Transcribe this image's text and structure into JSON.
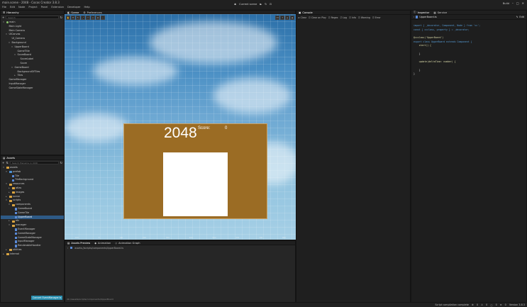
{
  "window": {
    "title": "main.scene - 2048 - Cocos Creator 3.8.3"
  },
  "menu": [
    "File",
    "Edit",
    "Node",
    "Project",
    "Panel",
    "Extension",
    "Developer",
    "Help"
  ],
  "toolbar": {
    "scene_select": "Current scene",
    "build": "Build"
  },
  "hierarchy": {
    "tab": "Hierarchy",
    "search_placeholder": "Search",
    "nodes": [
      {
        "label": "main",
        "depth": 0,
        "caret": "▾",
        "icon": "scene"
      },
      {
        "label": "Main Light",
        "depth": 1,
        "caret": "",
        "icon": "none"
      },
      {
        "label": "Main Camera",
        "depth": 1,
        "caret": "",
        "icon": "none"
      },
      {
        "label": "UICanvas",
        "depth": 1,
        "caret": "▾",
        "icon": "none"
      },
      {
        "label": "UI_Camera",
        "depth": 2,
        "caret": "",
        "icon": "none"
      },
      {
        "label": "Background",
        "depth": 2,
        "caret": "▾",
        "icon": "none"
      },
      {
        "label": "UpperBoard",
        "depth": 3,
        "caret": "▾",
        "icon": "none"
      },
      {
        "label": "GameTitle",
        "depth": 4,
        "caret": "",
        "icon": "none"
      },
      {
        "label": "ScoreBoard",
        "depth": 4,
        "caret": "▾",
        "icon": "none"
      },
      {
        "label": "ScoreLabel",
        "depth": 5,
        "caret": "",
        "icon": "none"
      },
      {
        "label": "Score",
        "depth": 5,
        "caret": "",
        "icon": "none"
      },
      {
        "label": "GameBoard",
        "depth": 3,
        "caret": "▾",
        "icon": "none"
      },
      {
        "label": "BackgroundOfTiles",
        "depth": 4,
        "caret": "",
        "icon": "none"
      },
      {
        "label": "Tiles",
        "depth": 4,
        "caret": "▸",
        "icon": "none"
      },
      {
        "label": "GameManager",
        "depth": 1,
        "caret": "",
        "icon": "none"
      },
      {
        "label": "InputManager",
        "depth": 1,
        "caret": "",
        "icon": "none"
      },
      {
        "label": "GameStateManager",
        "depth": 1,
        "caret": "",
        "icon": "none"
      }
    ]
  },
  "assets": {
    "tab": "Assets",
    "search_placeholder": "Search filename in UUID",
    "nodes": [
      {
        "label": "assets",
        "depth": 0,
        "caret": "▾",
        "icon": "folder",
        "selected": false
      },
      {
        "label": "prefab",
        "depth": 1,
        "caret": "▾",
        "icon": "folder-blue",
        "selected": false
      },
      {
        "label": "Tile",
        "depth": 2,
        "caret": "",
        "icon": "file",
        "selected": false
      },
      {
        "label": "TileBackground",
        "depth": 2,
        "caret": "",
        "icon": "file",
        "selected": false
      },
      {
        "label": "resources",
        "depth": 1,
        "caret": "▾",
        "icon": "folder",
        "selected": false
      },
      {
        "label": "atlas",
        "depth": 2,
        "caret": "▸",
        "icon": "folder",
        "selected": false
      },
      {
        "label": "images",
        "depth": 2,
        "caret": "▸",
        "icon": "folder",
        "selected": false
      },
      {
        "label": "scene",
        "depth": 1,
        "caret": "▸",
        "icon": "folder",
        "selected": false
      },
      {
        "label": "scripts",
        "depth": 1,
        "caret": "▾",
        "icon": "folder",
        "selected": false
      },
      {
        "label": "components",
        "depth": 2,
        "caret": "▾",
        "icon": "folder",
        "selected": false
      },
      {
        "label": "GameBoard",
        "depth": 3,
        "caret": "",
        "icon": "file",
        "selected": false
      },
      {
        "label": "GameTile",
        "depth": 3,
        "caret": "",
        "icon": "file",
        "selected": false
      },
      {
        "label": "UpperBoard",
        "depth": 3,
        "caret": "",
        "icon": "file",
        "selected": true
      },
      {
        "label": "etc",
        "depth": 2,
        "caret": "▸",
        "icon": "folder",
        "selected": false
      },
      {
        "label": "manager",
        "depth": 2,
        "caret": "▾",
        "icon": "folder",
        "selected": false
      },
      {
        "label": "EventManager",
        "depth": 3,
        "caret": "",
        "icon": "file",
        "selected": false
      },
      {
        "label": "GameManager",
        "depth": 3,
        "caret": "",
        "icon": "file",
        "selected": false
      },
      {
        "label": "GameStateManager",
        "depth": 3,
        "caret": "",
        "icon": "file",
        "selected": false
      },
      {
        "label": "InputManager",
        "depth": 3,
        "caret": "",
        "icon": "file",
        "selected": false
      },
      {
        "label": "RenderableHandler",
        "depth": 3,
        "caret": "",
        "icon": "file",
        "selected": false
      },
      {
        "label": "utilities",
        "depth": 1,
        "caret": "▸",
        "icon": "folder",
        "selected": false
      },
      {
        "label": "internal",
        "depth": 0,
        "caret": "▸",
        "icon": "folder",
        "selected": false
      }
    ],
    "footer_tag": "Convert EventManager.ts"
  },
  "scene": {
    "tabs": [
      "Scene",
      "Preferences"
    ],
    "game_title": "2048",
    "score_label": "Score:",
    "score_value": "0",
    "axis_ticks": [
      "-100",
      "0",
      "100",
      "200",
      "300",
      "400",
      "500",
      "600",
      "700",
      "800"
    ]
  },
  "bottom": {
    "tabs": [
      "Assets Preview",
      "Animation",
      "Animation Graph"
    ],
    "path": "assets://scripts/components/UpperBoard.ts",
    "status_path": "db://assets/scripts/components/UpperBoard"
  },
  "console": {
    "tab": "Console",
    "buttons": [
      "Clear",
      "Clear on Play",
      "Regex",
      "Log",
      "Info",
      "Warning",
      "Error"
    ]
  },
  "inspector": {
    "tabs": [
      "Inspector",
      "Service"
    ],
    "file_title": "UpperBoard.ts",
    "edit_label": "Edit",
    "code_lines": [
      "import { _decorator, Component, Node } from 'cc';",
      "const { ccclass, property } = _decorator;",
      "",
      "@ccclass('UpperBoard')",
      "export class UpperBoard extends Component {",
      "    start() {",
      "",
      "    }",
      "",
      "    update(deltaTime: number) {",
      "",
      "    }",
      "}"
    ]
  },
  "statusbar": {
    "compile": "Script compilation complete",
    "counts": [
      "0",
      "0",
      "0",
      "0"
    ],
    "version": "Version 3.8.3"
  },
  "colors": {
    "accent": "#2e5a86",
    "board": "#9b6c24"
  }
}
